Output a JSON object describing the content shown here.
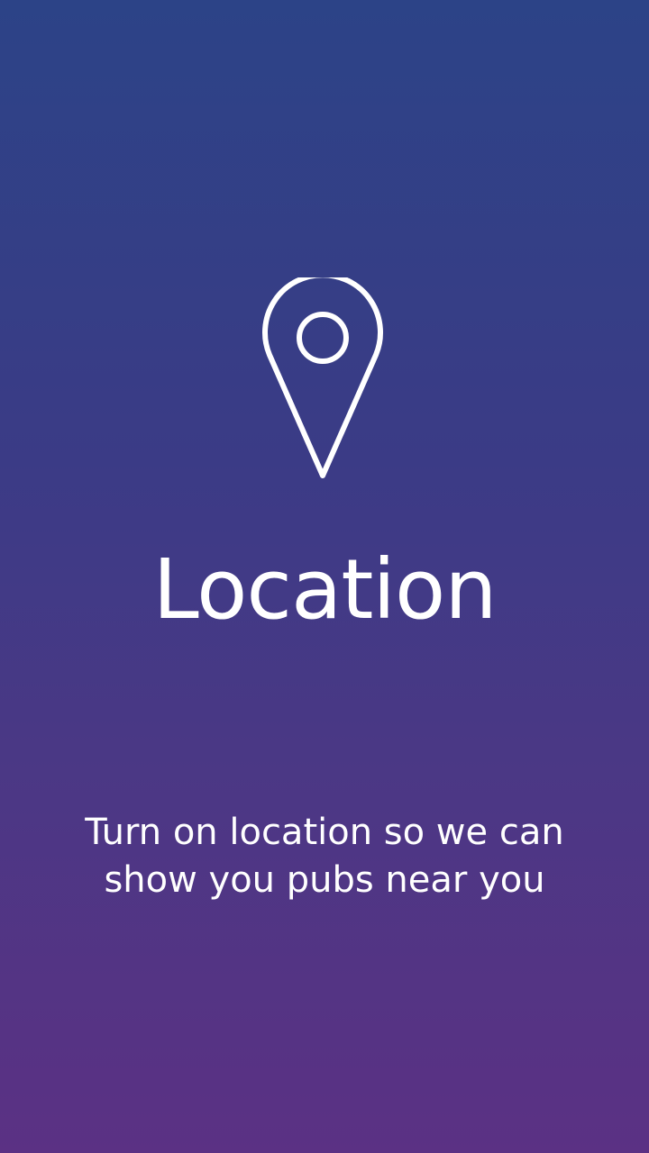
{
  "onboarding": {
    "icon": "location-pin-icon",
    "title": "Location",
    "message_line1": "Turn on location so we can",
    "message_line2": "show you pubs near you"
  },
  "colors": {
    "gradient_top": "#2c4387",
    "gradient_bottom": "#5b3184",
    "foreground": "#ffffff"
  }
}
